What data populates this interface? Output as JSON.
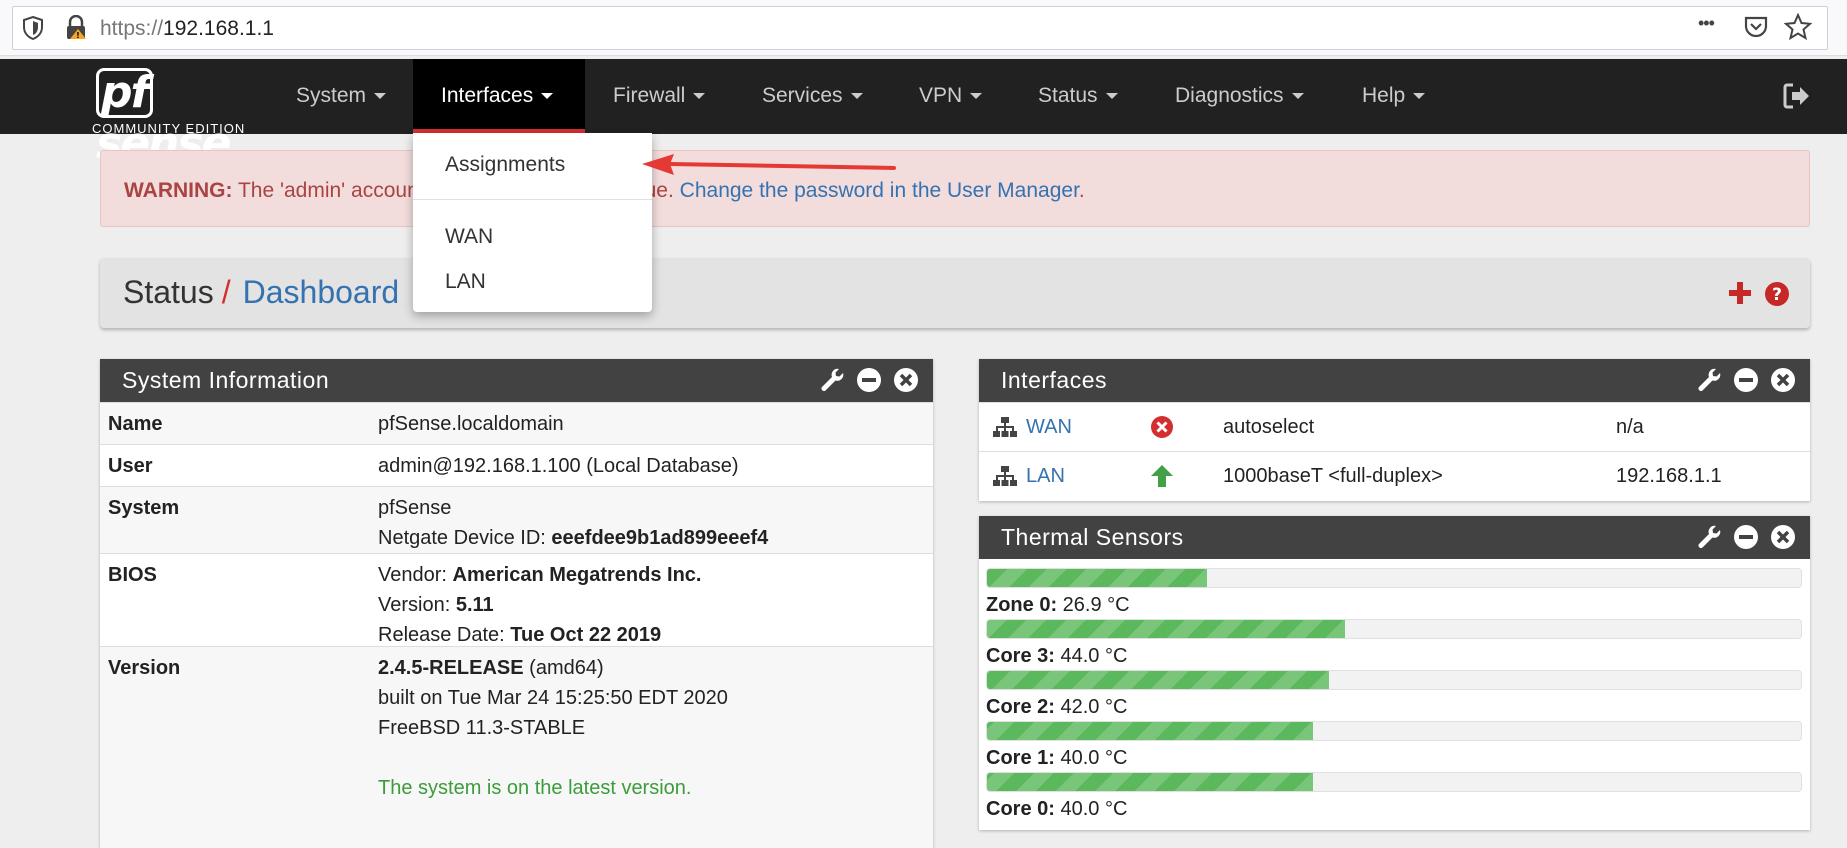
{
  "browser": {
    "url_protocol": "https://",
    "url_host": "192.168.1.1",
    "more_glyph": "•••"
  },
  "logo": {
    "main": "sense",
    "pf": "pf",
    "subtitle": "COMMUNITY EDITION"
  },
  "nav": {
    "items": [
      {
        "label": "System"
      },
      {
        "label": "Interfaces"
      },
      {
        "label": "Firewall"
      },
      {
        "label": "Services"
      },
      {
        "label": "VPN"
      },
      {
        "label": "Status"
      },
      {
        "label": "Diagnostics"
      },
      {
        "label": "Help"
      }
    ]
  },
  "dropdown": {
    "items": [
      "Assignments",
      "WAN",
      "LAN"
    ]
  },
  "warning": {
    "prefix": "WARNING:",
    "text_start": " The 'admin' account",
    "text_end": "efault value. ",
    "link": "Change the password in the User Manager",
    "suffix": "."
  },
  "breadcrumb": {
    "section": "Status",
    "separator": "/",
    "page": "Dashboard"
  },
  "system_info": {
    "title": "System Information",
    "rows": {
      "name": {
        "label": "Name",
        "value": "pfSense.localdomain"
      },
      "user": {
        "label": "User",
        "value": "admin@192.168.1.100 (Local Database)"
      },
      "system": {
        "label": "System",
        "line1": "pfSense",
        "line2_label": "Netgate Device ID: ",
        "line2_value": "eeefdee9b1ad899eeef4"
      },
      "bios": {
        "label": "BIOS",
        "vendor_label": "Vendor: ",
        "vendor": "American Megatrends Inc.",
        "version_label": "Version: ",
        "version": "5.11",
        "date_label": "Release Date: ",
        "date": "Tue Oct 22 2019"
      },
      "version": {
        "label": "Version",
        "release": "2.4.5-RELEASE",
        "arch": " (amd64)",
        "built": "built on Tue Mar 24 15:25:50 EDT 2020",
        "os": "FreeBSD 11.3-STABLE",
        "status": "The system is on the latest version."
      }
    }
  },
  "interfaces": {
    "title": "Interfaces",
    "rows": [
      {
        "name": "WAN",
        "status": "down",
        "media": "autoselect",
        "ip": "n/a"
      },
      {
        "name": "LAN",
        "status": "up",
        "media": "1000baseT <full-duplex>",
        "ip": "192.168.1.1"
      }
    ]
  },
  "thermal": {
    "title": "Thermal Sensors",
    "sensors": [
      {
        "name": "Zone 0:",
        "value": " 26.9 °C",
        "fill_pct": 27
      },
      {
        "name": "Core 3:",
        "value": " 44.0 °C",
        "fill_pct": 44
      },
      {
        "name": "Core 2:",
        "value": " 42.0 °C",
        "fill_pct": 42
      },
      {
        "name": "Core 1:",
        "value": " 40.0 °C",
        "fill_pct": 40
      },
      {
        "name": "Core 0:",
        "value": " 40.0 °C",
        "fill_pct": 40
      }
    ]
  },
  "colors": {
    "navbar_bg": "#212121",
    "active_underline": "#d32f2f",
    "link": "#3572b0",
    "warning_bg": "#f3dcdc",
    "warning_text": "#a94442",
    "panel_head": "#424242",
    "bar_fill": "#5cb85c",
    "status_down": "#d32f2f",
    "status_up": "#43a047"
  },
  "icons": {
    "browser": [
      "shield-icon",
      "lock-icon",
      "more-icon",
      "pocket-icon",
      "star-icon"
    ],
    "navbar": [
      "logout-icon"
    ],
    "breadcrumb": [
      "plus-icon",
      "help-icon"
    ],
    "panel_controls": [
      "wrench-icon",
      "minimize-icon",
      "close-icon"
    ],
    "interfaces": [
      "network-icon",
      "status-down-icon",
      "status-up-icon"
    ]
  }
}
